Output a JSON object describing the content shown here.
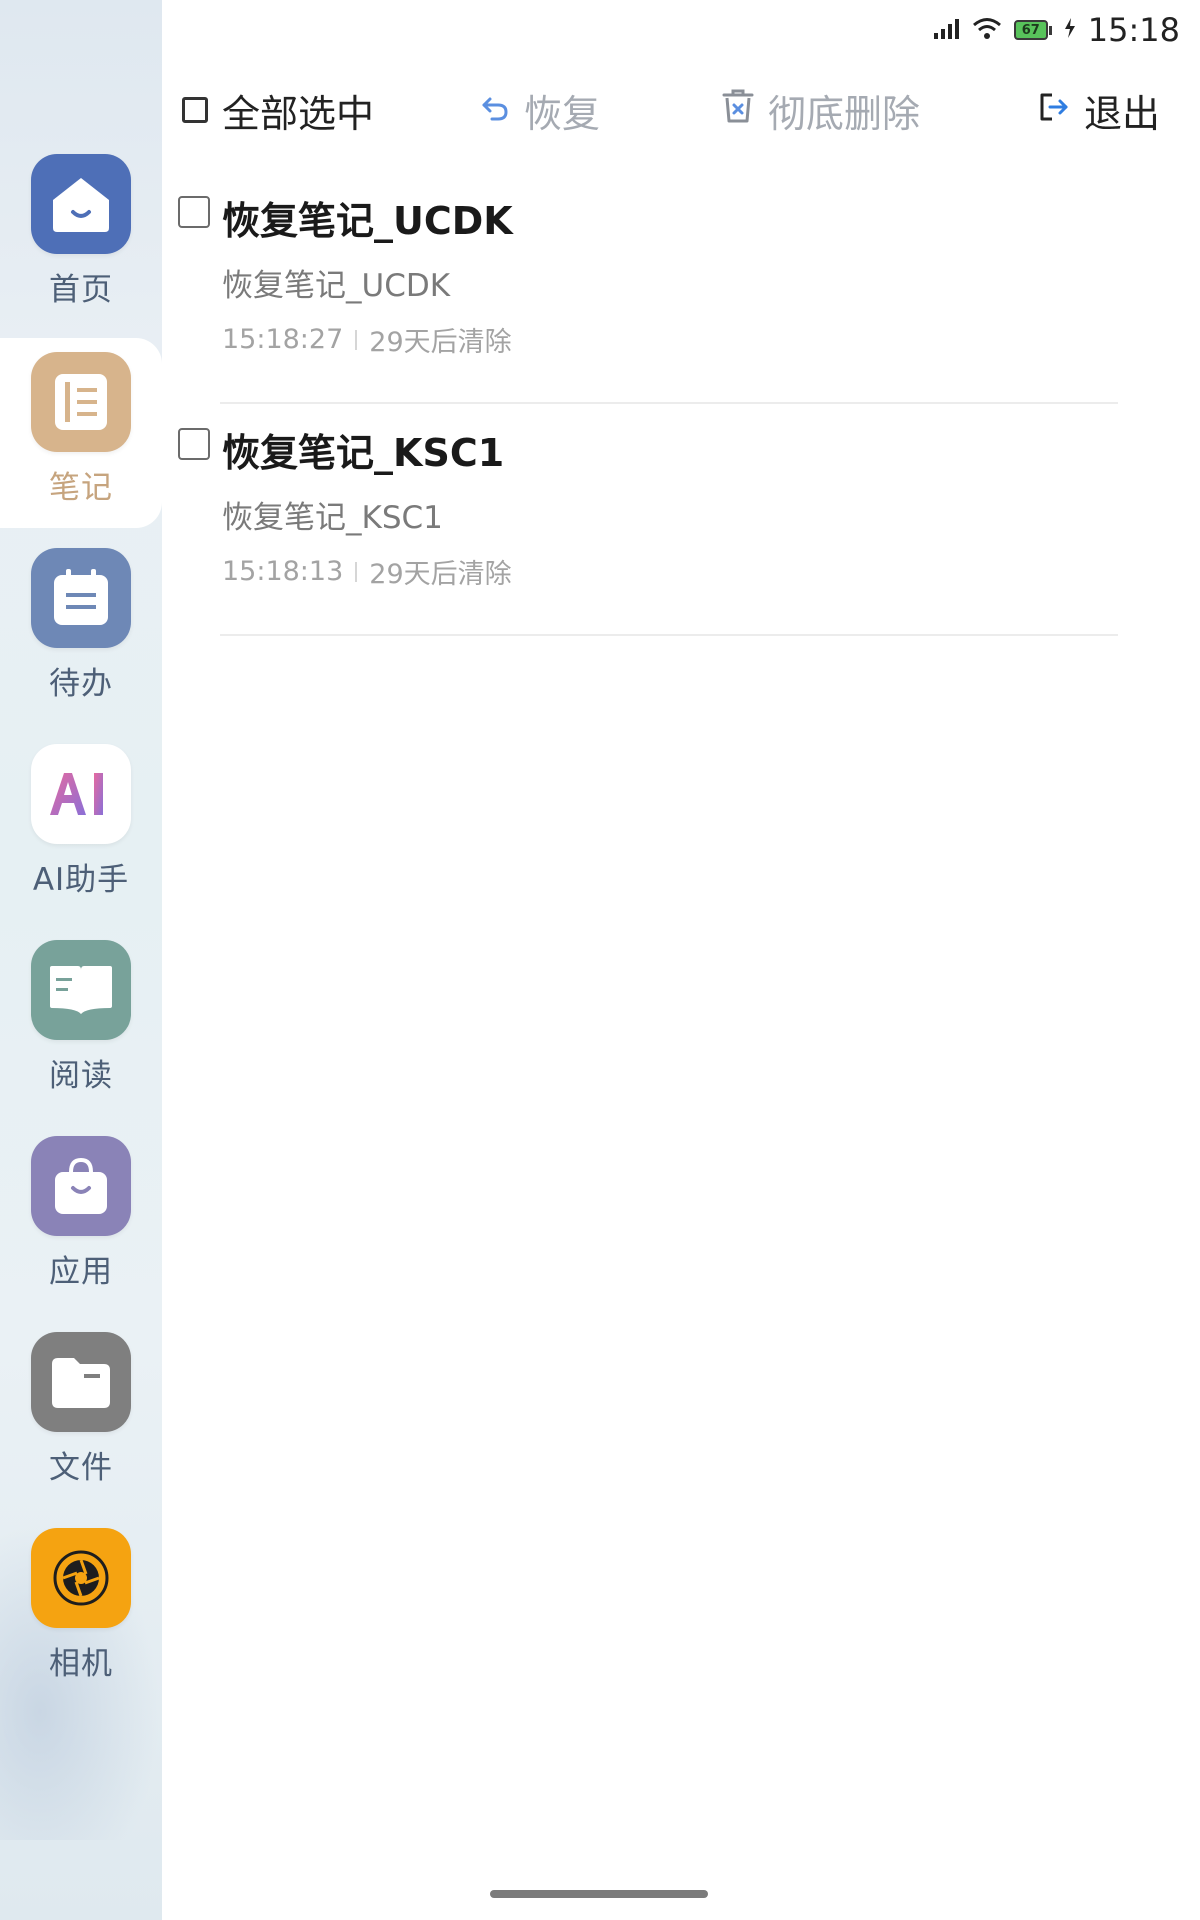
{
  "status_bar": {
    "time": "15:18",
    "battery": "67"
  },
  "toolbar": {
    "select_all": "全部选中",
    "restore": "恢复",
    "delete_forever": "彻底删除",
    "exit": "退出"
  },
  "sidebar": {
    "items": [
      {
        "label": "首页",
        "icon": "home-icon",
        "color": "#4e6fb7"
      },
      {
        "label": "笔记",
        "icon": "notebook-icon",
        "color": "#d7b48c"
      },
      {
        "label": "待办",
        "icon": "calendar-icon",
        "color": "#6e88b6"
      },
      {
        "label": "AI助手",
        "icon": "ai-icon",
        "color": "#ffffff"
      },
      {
        "label": "阅读",
        "icon": "book-icon",
        "color": "#78a29a"
      },
      {
        "label": "应用",
        "icon": "bag-icon",
        "color": "#8a83b7"
      },
      {
        "label": "文件",
        "icon": "folder-icon",
        "color": "#7f7f7f"
      },
      {
        "label": "相机",
        "icon": "camera-icon",
        "color": "#f5a311"
      }
    ]
  },
  "notes": [
    {
      "title": "恢复笔记_UCDK",
      "preview": "恢复笔记_UCDK",
      "time": "15:18:27",
      "expiry": "29天后清除"
    },
    {
      "title": "恢复笔记_KSC1",
      "preview": "恢复笔记_KSC1",
      "time": "15:18:13",
      "expiry": "29天后清除"
    }
  ]
}
